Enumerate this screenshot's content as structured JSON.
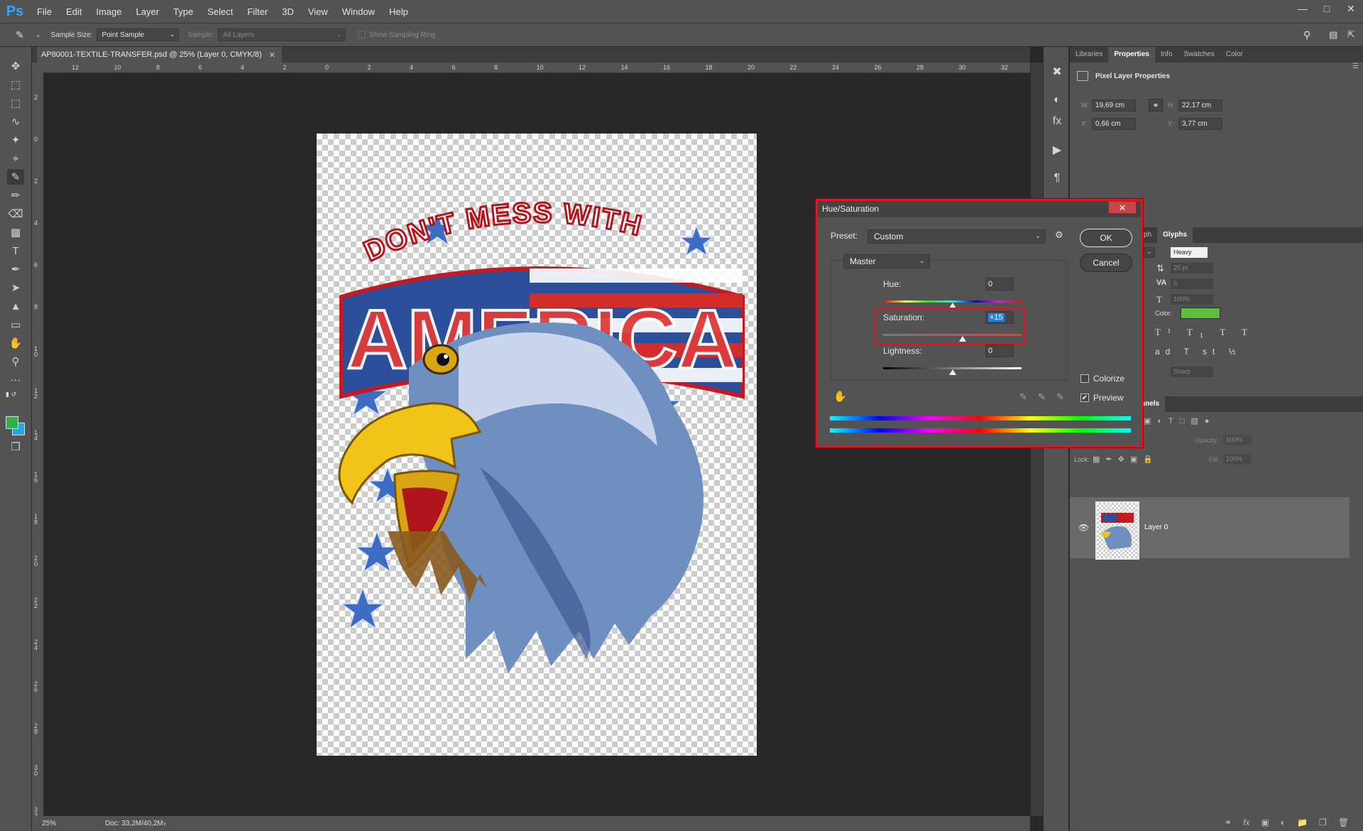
{
  "app": {
    "logo": "Ps",
    "menu": [
      "File",
      "Edit",
      "Image",
      "Layer",
      "Type",
      "Select",
      "Filter",
      "3D",
      "View",
      "Window",
      "Help"
    ]
  },
  "options_bar": {
    "sample_size_label": "Sample Size:",
    "sample_size_value": "Point Sample",
    "sample_label": "Sample:",
    "sample_value": "All Layers",
    "show_sampling_ring": "Show Sampling Ring"
  },
  "document": {
    "tab_title": "AP80001-TEXTILE-TRANSFER.psd @ 25% (Layer 0, CMYK/8)",
    "zoom": "25%",
    "doc_size": "Doc: 33,2M/40,2M",
    "ruler_h": [
      "12",
      "10",
      "8",
      "6",
      "4",
      "2",
      "0",
      "2",
      "4",
      "6",
      "8",
      "10",
      "12",
      "14",
      "16",
      "18",
      "20",
      "22",
      "24",
      "26",
      "28",
      "30",
      "32"
    ],
    "ruler_v": [
      "2",
      "0",
      "2",
      "4",
      "6",
      "8",
      "10",
      "12",
      "14",
      "16",
      "18",
      "20",
      "22",
      "24",
      "26",
      "28",
      "30",
      "32"
    ]
  },
  "properties": {
    "tabs": [
      "Libraries",
      "Properties",
      "Info",
      "Swatches",
      "Color"
    ],
    "heading": "Pixel Layer Properties",
    "w_label": "W:",
    "w_value": "19,69 cm",
    "h_label": "H:",
    "h_value": "22,17 cm",
    "x_label": "X:",
    "x_value": "0,66 cm",
    "y_label": "Y:",
    "y_value": "3,77 cm"
  },
  "character": {
    "tabs": [
      "ph",
      "Glyphs"
    ],
    "font_style": "Heavy",
    "font_size": "25 pt",
    "tracking": "0",
    "scale": "100%",
    "color_label": "Color:",
    "color": "#5cbf40",
    "antialias": "Sharp"
  },
  "layers": {
    "tab": "nnels",
    "opacity_label": "Opacity:",
    "opacity": "100%",
    "lock_label": "Lock:",
    "fill_label": "Fill:",
    "fill": "100%",
    "layer_name": "Layer 0"
  },
  "dialog": {
    "title": "Hue/Saturation",
    "close": "✕",
    "preset_label": "Preset:",
    "preset_value": "Custom",
    "channel": "Master",
    "hue_label": "Hue:",
    "hue_value": "0",
    "hue": 0,
    "saturation_label": "Saturation:",
    "saturation_value": "+15",
    "saturation": 15,
    "lightness_label": "Lightness:",
    "lightness_value": "0",
    "lightness": 0,
    "ok": "OK",
    "cancel": "Cancel",
    "colorize": "Colorize",
    "colorize_checked": false,
    "preview": "Preview",
    "preview_checked": true
  },
  "colors": {
    "foreground": "#2fb24a",
    "background": "#27a4e6",
    "highlight": "#e81123"
  }
}
